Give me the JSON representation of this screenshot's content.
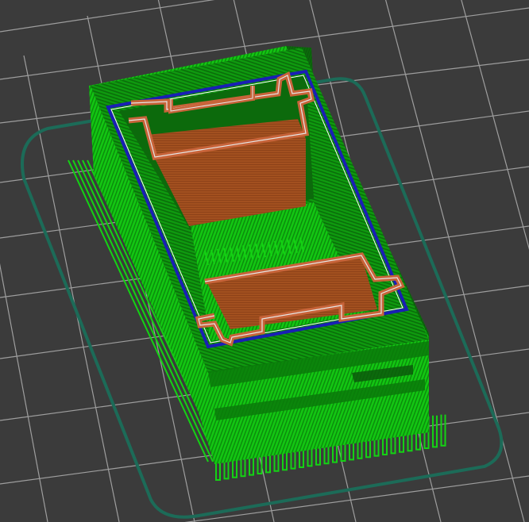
{
  "viewer": {
    "view": "3d-gcode-preview",
    "colors": {
      "background": "#3b3b3b",
      "bed_grid": "#a9a9a9",
      "skirt": "#1c6b58",
      "support": "#14d214",
      "external_perimeter": "#0a8a0a",
      "infill": "#a04c20",
      "perimeter_inner": "#d9d9d9",
      "travel_outline": "#1a1fb5"
    }
  }
}
